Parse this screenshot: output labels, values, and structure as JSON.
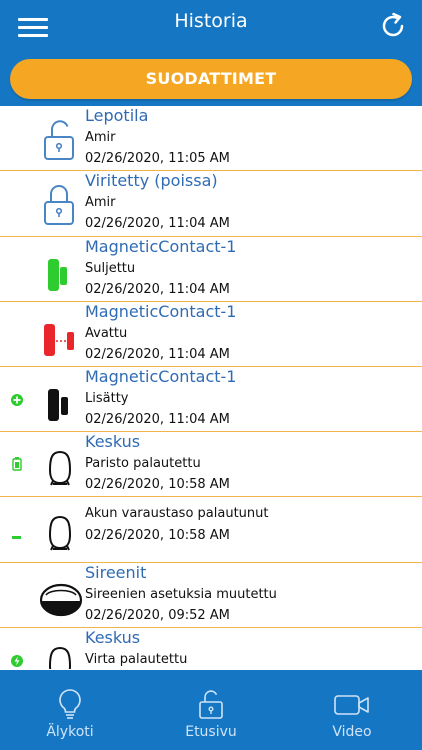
{
  "header": {
    "title": "Historia",
    "menu_icon": "hamburger-icon",
    "refresh_icon": "refresh-icon",
    "background": "#1577c4"
  },
  "filter_button": {
    "label": "SUODATTIMET",
    "color": "#f5a623"
  },
  "events": [
    {
      "title": "Lepotila",
      "subtitle": "Amir",
      "time": "02/26/2020, 11:05 AM",
      "icon": "lock-open-icon",
      "status_icon": ""
    },
    {
      "title": "Viritetty (poissa)",
      "subtitle": "Amir",
      "time": "02/26/2020, 11:04 AM",
      "icon": "lock-closed-icon",
      "status_icon": ""
    },
    {
      "title": "MagneticContact-1",
      "subtitle": "Suljettu",
      "time": "02/26/2020, 11:04 AM",
      "icon": "magnetic-contact-closed-icon",
      "status_icon": ""
    },
    {
      "title": "MagneticContact-1",
      "subtitle": "Avattu",
      "time": "02/26/2020, 11:04 AM",
      "icon": "magnetic-contact-open-icon",
      "status_icon": ""
    },
    {
      "title": "MagneticContact-1",
      "subtitle": "Lisätty",
      "time": "02/26/2020, 11:04 AM",
      "icon": "magnetic-contact-icon",
      "status_icon": "added-plus-icon"
    },
    {
      "title": "Keskus",
      "subtitle": "Paristo palautettu",
      "time": "02/26/2020, 10:58 AM",
      "icon": "hub-icon",
      "status_icon": "battery-icon"
    },
    {
      "title": "",
      "subtitle": "Akun varaustaso palautunut",
      "time": "02/26/2020, 10:58 AM",
      "icon": "hub-icon",
      "status_icon": "battery-level-icon"
    },
    {
      "title": "Sireenit",
      "subtitle": "Sireenien asetuksia muutettu",
      "time": "02/26/2020, 09:52 AM",
      "icon": "siren-icon",
      "status_icon": ""
    },
    {
      "title": "Keskus",
      "subtitle": "Virta palautettu",
      "time": "",
      "icon": "hub-icon",
      "status_icon": "power-icon"
    }
  ],
  "bottom_nav": [
    {
      "label": "Älykoti",
      "icon": "lightbulb-icon"
    },
    {
      "label": "Etusivu",
      "icon": "lock-open-icon"
    },
    {
      "label": "Video",
      "icon": "video-camera-icon"
    }
  ],
  "colors": {
    "accent": "#f5a623",
    "title_text": "#2f6bb3",
    "green": "#2ecc2e",
    "red": "#e8262b",
    "divider": "#f0b44a"
  }
}
